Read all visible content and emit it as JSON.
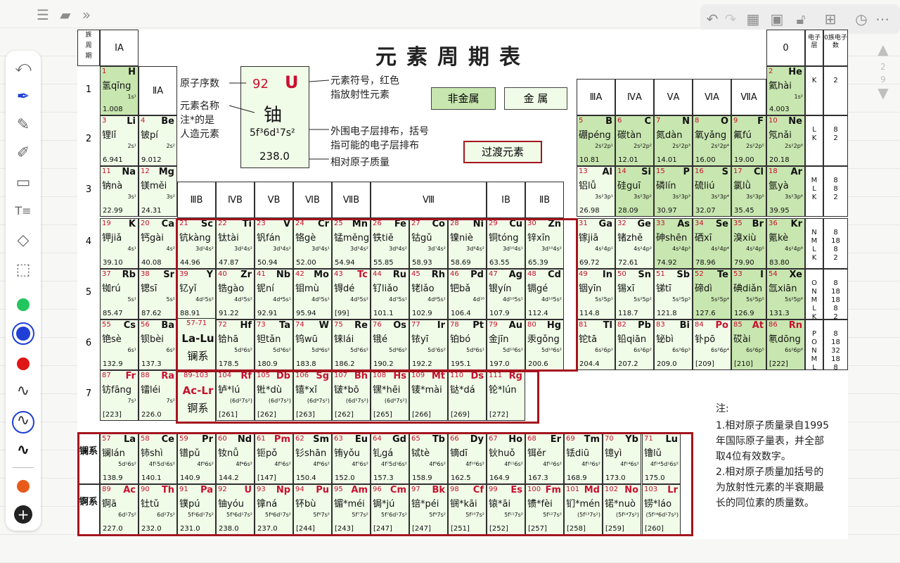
{
  "page": {
    "title": "元素周期表"
  },
  "toolbar_icons": [
    "undo-icon",
    "redo-icon",
    "hatch-icon",
    "save-icon",
    "lock-icon",
    "export-icon",
    "clock-icon",
    "more-icon"
  ],
  "pager": {
    "current": "2",
    "total": "9"
  },
  "colors": {
    "nonmetal": "#c8e6b0",
    "metal": "#f0fbe8",
    "border_red": "#a4151f",
    "symbol_red": "#c8102e",
    "tool_green": "#22c55e",
    "tool_blue": "#1f3fd6",
    "tool_red": "#e01515",
    "tool_orange": "#e85a1a"
  },
  "headers": {
    "corner_top": "族",
    "corner_mid": "周",
    "corner_bottom": "期",
    "g1": "ⅠA",
    "g2": "ⅡA",
    "g13": "ⅢA",
    "g14": "ⅣA",
    "g15": "ⅤA",
    "g16": "ⅥA",
    "g17": "ⅦA",
    "g0": "0",
    "shell_header": "电子层",
    "count_header": "0族电子数",
    "tm": [
      "ⅢB",
      "ⅣB",
      "ⅤB",
      "ⅥB",
      "ⅦB",
      "Ⅷ",
      "ⅠB",
      "ⅡB"
    ]
  },
  "periods": [
    "1",
    "2",
    "3",
    "4",
    "5",
    "6",
    "7"
  ],
  "legend": {
    "z": "92",
    "sym": "U",
    "name": "铀",
    "config": "5f³6d¹7s²",
    "mass": "238.0",
    "l_z": "原子序数",
    "l_name": "元素名称",
    "l_star1": "注*的是",
    "l_star2": "人造元素",
    "l_sym1": "元素符号，红色",
    "l_sym2": "指放射性元素",
    "l_cfg1": "外围电子层排布，括号",
    "l_cfg2": "指可能的电子层排布",
    "l_mass": "相对原子质量",
    "nonmetal": "非金属",
    "metal": "金 属",
    "transition": "过渡元素"
  },
  "series_labels": {
    "la": "镧系",
    "ac": "锕系",
    "la_ref": "57-71",
    "la_sym": "La-Lu",
    "ac_ref": "89-103",
    "ac_sym": "Ac-Lr"
  },
  "notes": {
    "title": "注:",
    "lines": [
      "1.相对原子质量录自1995",
      "年国际原子量表，并全部",
      "取4位有效数字。",
      "2.相对原子质量加括号的",
      "为放射性元素的半衰期最",
      "长的同位素的质量数。"
    ]
  },
  "elements": [
    {
      "z": "1",
      "sym": "H",
      "name": "氢qīng",
      "cfg": "1s¹",
      "mass": "1.008",
      "row": 1,
      "col": 1,
      "t": "nm"
    },
    {
      "z": "2",
      "sym": "He",
      "name": "氦hài",
      "cfg": "1s²",
      "mass": "4.003",
      "row": 1,
      "col": 18,
      "t": "nm"
    },
    {
      "z": "3",
      "sym": "Li",
      "name": "锂lǐ",
      "cfg": "2s¹",
      "mass": "6.941",
      "row": 2,
      "col": 1,
      "t": "mt"
    },
    {
      "z": "4",
      "sym": "Be",
      "name": "铍pí",
      "cfg": "2s²",
      "mass": "9.012",
      "row": 2,
      "col": 2,
      "t": "mt"
    },
    {
      "z": "5",
      "sym": "B",
      "name": "硼péng",
      "cfg": "2s²2p¹",
      "mass": "10.81",
      "row": 2,
      "col": 13,
      "t": "nm"
    },
    {
      "z": "6",
      "sym": "C",
      "name": "碳tàn",
      "cfg": "2s²2p²",
      "mass": "12.01",
      "row": 2,
      "col": 14,
      "t": "nm"
    },
    {
      "z": "7",
      "sym": "N",
      "name": "氮dàn",
      "cfg": "2s²2p³",
      "mass": "14.01",
      "row": 2,
      "col": 15,
      "t": "nm"
    },
    {
      "z": "8",
      "sym": "O",
      "name": "氧yǎng",
      "cfg": "2s²2p⁴",
      "mass": "16.00",
      "row": 2,
      "col": 16,
      "t": "nm"
    },
    {
      "z": "9",
      "sym": "F",
      "name": "氟fú",
      "cfg": "2s²2p⁵",
      "mass": "19.00",
      "row": 2,
      "col": 17,
      "t": "nm"
    },
    {
      "z": "10",
      "sym": "Ne",
      "name": "氖nǎi",
      "cfg": "2s²2p⁶",
      "mass": "20.18",
      "row": 2,
      "col": 18,
      "t": "nm"
    },
    {
      "z": "11",
      "sym": "Na",
      "name": "钠nà",
      "cfg": "3s¹",
      "mass": "22.99",
      "row": 3,
      "col": 1,
      "t": "mt"
    },
    {
      "z": "12",
      "sym": "Mg",
      "name": "镁měi",
      "cfg": "3s²",
      "mass": "24.31",
      "row": 3,
      "col": 2,
      "t": "mt"
    },
    {
      "z": "13",
      "sym": "Al",
      "name": "铝lǚ",
      "cfg": "3s²3p¹",
      "mass": "26.98",
      "row": 3,
      "col": 13,
      "t": "mt"
    },
    {
      "z": "14",
      "sym": "Si",
      "name": "硅guī",
      "cfg": "3s²3p²",
      "mass": "28.09",
      "row": 3,
      "col": 14,
      "t": "nm"
    },
    {
      "z": "15",
      "sym": "P",
      "name": "磷lín",
      "cfg": "3s²3p³",
      "mass": "30.97",
      "row": 3,
      "col": 15,
      "t": "nm"
    },
    {
      "z": "16",
      "sym": "S",
      "name": "硫liú",
      "cfg": "3s²3p⁴",
      "mass": "32.07",
      "row": 3,
      "col": 16,
      "t": "nm"
    },
    {
      "z": "17",
      "sym": "Cl",
      "name": "氯lǜ",
      "cfg": "3s²3p⁵",
      "mass": "35.45",
      "row": 3,
      "col": 17,
      "t": "nm"
    },
    {
      "z": "18",
      "sym": "Ar",
      "name": "氩yà",
      "cfg": "3s²3p⁶",
      "mass": "39.95",
      "row": 3,
      "col": 18,
      "t": "nm"
    },
    {
      "z": "19",
      "sym": "K",
      "name": "钾jiǎ",
      "cfg": "4s¹",
      "mass": "39.10",
      "row": 4,
      "col": 1,
      "t": "mt"
    },
    {
      "z": "20",
      "sym": "Ca",
      "name": "钙gài",
      "cfg": "4s²",
      "mass": "40.08",
      "row": 4,
      "col": 2,
      "t": "mt"
    },
    {
      "z": "21",
      "sym": "Sc",
      "name": "钪kàng",
      "cfg": "3d¹4s²",
      "mass": "44.96",
      "row": 4,
      "col": 3,
      "t": "mt"
    },
    {
      "z": "22",
      "sym": "Ti",
      "name": "钛tài",
      "cfg": "3d²4s²",
      "mass": "47.87",
      "row": 4,
      "col": 4,
      "t": "mt"
    },
    {
      "z": "23",
      "sym": "V",
      "name": "钒fán",
      "cfg": "3d³4s²",
      "mass": "50.94",
      "row": 4,
      "col": 5,
      "t": "mt"
    },
    {
      "z": "24",
      "sym": "Cr",
      "name": "铬gè",
      "cfg": "3d⁵4s¹",
      "mass": "52.00",
      "row": 4,
      "col": 6,
      "t": "mt"
    },
    {
      "z": "25",
      "sym": "Mn",
      "name": "锰měng",
      "cfg": "3d⁵4s²",
      "mass": "54.94",
      "row": 4,
      "col": 7,
      "t": "mt"
    },
    {
      "z": "26",
      "sym": "Fe",
      "name": "铁tiě",
      "cfg": "3d⁶4s²",
      "mass": "55.85",
      "row": 4,
      "col": 8,
      "t": "mt"
    },
    {
      "z": "27",
      "sym": "Co",
      "name": "钴gǔ",
      "cfg": "3d⁷4s²",
      "mass": "58.93",
      "row": 4,
      "col": 9,
      "t": "mt"
    },
    {
      "z": "28",
      "sym": "Ni",
      "name": "镍niè",
      "cfg": "3d⁸4s²",
      "mass": "58.69",
      "row": 4,
      "col": 10,
      "t": "mt"
    },
    {
      "z": "29",
      "sym": "Cu",
      "name": "铜tóng",
      "cfg": "3d¹⁰4s¹",
      "mass": "63.55",
      "row": 4,
      "col": 11,
      "t": "mt"
    },
    {
      "z": "30",
      "sym": "Zn",
      "name": "锌xīn",
      "cfg": "3d¹⁰4s²",
      "mass": "65.39",
      "row": 4,
      "col": 12,
      "t": "mt"
    },
    {
      "z": "31",
      "sym": "Ga",
      "name": "镓jiā",
      "cfg": "4s²4p¹",
      "mass": "69.72",
      "row": 4,
      "col": 13,
      "t": "mt"
    },
    {
      "z": "32",
      "sym": "Ge",
      "name": "锗zhě",
      "cfg": "4s²4p²",
      "mass": "72.61",
      "row": 4,
      "col": 14,
      "t": "mt"
    },
    {
      "z": "33",
      "sym": "As",
      "name": "砷shēn",
      "cfg": "4s²4p³",
      "mass": "74.92",
      "row": 4,
      "col": 15,
      "t": "nm"
    },
    {
      "z": "34",
      "sym": "Se",
      "name": "硒xī",
      "cfg": "4s²4p⁴",
      "mass": "78.96",
      "row": 4,
      "col": 16,
      "t": "nm"
    },
    {
      "z": "35",
      "sym": "Br",
      "name": "溴xiù",
      "cfg": "4s²4p⁵",
      "mass": "79.90",
      "row": 4,
      "col": 17,
      "t": "nm"
    },
    {
      "z": "36",
      "sym": "Kr",
      "name": "氪kè",
      "cfg": "4s²4p⁶",
      "mass": "83.80",
      "row": 4,
      "col": 18,
      "t": "nm"
    },
    {
      "z": "37",
      "sym": "Rb",
      "name": "铷rú",
      "cfg": "5s¹",
      "mass": "85.47",
      "row": 5,
      "col": 1,
      "t": "mt"
    },
    {
      "z": "38",
      "sym": "Sr",
      "name": "锶sī",
      "cfg": "5s²",
      "mass": "87.62",
      "row": 5,
      "col": 2,
      "t": "mt"
    },
    {
      "z": "39",
      "sym": "Y",
      "name": "钇yǐ",
      "cfg": "4d¹5s²",
      "mass": "88.91",
      "row": 5,
      "col": 3,
      "t": "mt"
    },
    {
      "z": "40",
      "sym": "Zr",
      "name": "锆gào",
      "cfg": "4d²5s²",
      "mass": "91.22",
      "row": 5,
      "col": 4,
      "t": "mt"
    },
    {
      "z": "41",
      "sym": "Nb",
      "name": "铌ní",
      "cfg": "4d⁴5s¹",
      "mass": "92.91",
      "row": 5,
      "col": 5,
      "t": "mt"
    },
    {
      "z": "42",
      "sym": "Mo",
      "name": "钼mù",
      "cfg": "4d⁵5s¹",
      "mass": "95.94",
      "row": 5,
      "col": 6,
      "t": "mt"
    },
    {
      "z": "43",
      "sym": "Tc",
      "name": "锝dé",
      "cfg": "4d⁵5s²",
      "mass": "[99]",
      "row": 5,
      "col": 7,
      "t": "mt"
    },
    {
      "z": "44",
      "sym": "Ru",
      "name": "钌liǎo",
      "cfg": "4d⁷5s¹",
      "mass": "101.1",
      "row": 5,
      "col": 8,
      "t": "mt"
    },
    {
      "z": "45",
      "sym": "Rh",
      "name": "铑lǎo",
      "cfg": "4d⁸5s¹",
      "mass": "102.9",
      "row": 5,
      "col": 9,
      "t": "mt"
    },
    {
      "z": "46",
      "sym": "Pd",
      "name": "钯bǎ",
      "cfg": "4d¹⁰",
      "mass": "106.4",
      "row": 5,
      "col": 10,
      "t": "mt"
    },
    {
      "z": "47",
      "sym": "Ag",
      "name": "银yín",
      "cfg": "4d¹⁰5s¹",
      "mass": "107.9",
      "row": 5,
      "col": 11,
      "t": "mt"
    },
    {
      "z": "48",
      "sym": "Cd",
      "name": "镉gé",
      "cfg": "4d¹⁰5s²",
      "mass": "112.4",
      "row": 5,
      "col": 12,
      "t": "mt"
    },
    {
      "z": "49",
      "sym": "In",
      "name": "铟yīn",
      "cfg": "5s²5p¹",
      "mass": "114.8",
      "row": 5,
      "col": 13,
      "t": "mt"
    },
    {
      "z": "50",
      "sym": "Sn",
      "name": "锡xī",
      "cfg": "5s²5p²",
      "mass": "118.7",
      "row": 5,
      "col": 14,
      "t": "mt"
    },
    {
      "z": "51",
      "sym": "Sb",
      "name": "锑tī",
      "cfg": "5s²5p³",
      "mass": "121.8",
      "row": 5,
      "col": 15,
      "t": "mt"
    },
    {
      "z": "52",
      "sym": "Te",
      "name": "碲dì",
      "cfg": "5s²5p⁴",
      "mass": "127.6",
      "row": 5,
      "col": 16,
      "t": "nm"
    },
    {
      "z": "53",
      "sym": "I",
      "name": "碘diǎn",
      "cfg": "5s²5p⁵",
      "mass": "126.9",
      "row": 5,
      "col": 17,
      "t": "nm"
    },
    {
      "z": "54",
      "sym": "Xe",
      "name": "氙xiān",
      "cfg": "5s²5p⁶",
      "mass": "131.3",
      "row": 5,
      "col": 18,
      "t": "nm"
    },
    {
      "z": "55",
      "sym": "Cs",
      "name": "铯sè",
      "cfg": "6s¹",
      "mass": "132.9",
      "row": 6,
      "col": 1,
      "t": "mt"
    },
    {
      "z": "56",
      "sym": "Ba",
      "name": "钡bèi",
      "cfg": "6s²",
      "mass": "137.3",
      "row": 6,
      "col": 2,
      "t": "mt"
    },
    {
      "z": "72",
      "sym": "Hf",
      "name": "铪hā",
      "cfg": "5d²6s²",
      "mass": "178.5",
      "row": 6,
      "col": 4,
      "t": "mt"
    },
    {
      "z": "73",
      "sym": "Ta",
      "name": "钽tǎn",
      "cfg": "5d³6s²",
      "mass": "180.9",
      "row": 6,
      "col": 5,
      "t": "mt"
    },
    {
      "z": "74",
      "sym": "W",
      "name": "钨wū",
      "cfg": "5d⁴6s²",
      "mass": "183.8",
      "row": 6,
      "col": 6,
      "t": "mt"
    },
    {
      "z": "75",
      "sym": "Re",
      "name": "铼lái",
      "cfg": "5d⁵6s²",
      "mass": "186.2",
      "row": 6,
      "col": 7,
      "t": "mt"
    },
    {
      "z": "76",
      "sym": "Os",
      "name": "锇é",
      "cfg": "5d⁶6s²",
      "mass": "190.2",
      "row": 6,
      "col": 8,
      "t": "mt"
    },
    {
      "z": "77",
      "sym": "Ir",
      "name": "铱yī",
      "cfg": "5d⁷6s²",
      "mass": "192.2",
      "row": 6,
      "col": 9,
      "t": "mt"
    },
    {
      "z": "78",
      "sym": "Pt",
      "name": "铂bó",
      "cfg": "5d⁹6s¹",
      "mass": "195.1",
      "row": 6,
      "col": 10,
      "t": "mt"
    },
    {
      "z": "79",
      "sym": "Au",
      "name": "金jīn",
      "cfg": "5d¹⁰6s¹",
      "mass": "197.0",
      "row": 6,
      "col": 11,
      "t": "mt"
    },
    {
      "z": "80",
      "sym": "Hg",
      "name": "汞gǒng",
      "cfg": "5d¹⁰6s²",
      "mass": "200.6",
      "row": 6,
      "col": 12,
      "t": "mt"
    },
    {
      "z": "81",
      "sym": "Tl",
      "name": "铊tā",
      "cfg": "6s²6p¹",
      "mass": "204.4",
      "row": 6,
      "col": 13,
      "t": "mt"
    },
    {
      "z": "82",
      "sym": "Pb",
      "name": "铅qiān",
      "cfg": "6s²6p²",
      "mass": "207.2",
      "row": 6,
      "col": 14,
      "t": "mt"
    },
    {
      "z": "83",
      "sym": "Bi",
      "name": "铋bì",
      "cfg": "6s²6p³",
      "mass": "209.0",
      "row": 6,
      "col": 15,
      "t": "mt"
    },
    {
      "z": "84",
      "sym": "Po",
      "name": "钋pō",
      "cfg": "6s²6p⁴",
      "mass": "[209]",
      "row": 6,
      "col": 16,
      "t": "mt"
    },
    {
      "z": "85",
      "sym": "At",
      "name": "砹ài",
      "cfg": "6s²6p⁵",
      "mass": "[210]",
      "row": 6,
      "col": 17,
      "t": "nm"
    },
    {
      "z": "86",
      "sym": "Rn",
      "name": "氡dōng",
      "cfg": "6s²6p⁶",
      "mass": "[222]",
      "row": 6,
      "col": 18,
      "t": "nm"
    },
    {
      "z": "87",
      "sym": "Fr",
      "name": "钫fāng",
      "cfg": "7s¹",
      "mass": "[223]",
      "row": 7,
      "col": 1,
      "t": "mt"
    },
    {
      "z": "88",
      "sym": "Ra",
      "name": "镭léi",
      "cfg": "7s²",
      "mass": "226.0",
      "row": 7,
      "col": 2,
      "t": "mt"
    },
    {
      "z": "104",
      "sym": "Rf",
      "name": "𬬻*lú",
      "cfg": "(6d²7s²)",
      "mass": "[261]",
      "row": 7,
      "col": 4,
      "t": "mt"
    },
    {
      "z": "105",
      "sym": "Db",
      "name": "𬭊*dù",
      "cfg": "(6d³7s²)",
      "mass": "[262]",
      "row": 7,
      "col": 5,
      "t": "mt"
    },
    {
      "z": "106",
      "sym": "Sg",
      "name": "𬭳*xǐ",
      "cfg": "(6d⁴7s²)",
      "mass": "[263]",
      "row": 7,
      "col": 6,
      "t": "mt"
    },
    {
      "z": "107",
      "sym": "Bh",
      "name": "𬭛*bō",
      "cfg": "(6d⁵7s²)",
      "mass": "[262]",
      "row": 7,
      "col": 7,
      "t": "mt"
    },
    {
      "z": "108",
      "sym": "Hs",
      "name": "𬭶*hēi",
      "cfg": "(6d⁶7s²)",
      "mass": "[265]",
      "row": 7,
      "col": 8,
      "t": "mt"
    },
    {
      "z": "109",
      "sym": "Mt",
      "name": "鿏*mài",
      "cfg": "",
      "mass": "[266]",
      "row": 7,
      "col": 9,
      "t": "mt"
    },
    {
      "z": "110",
      "sym": "Ds",
      "name": "𫟼*dá",
      "cfg": "",
      "mass": "[269]",
      "row": 7,
      "col": 10,
      "t": "mt"
    },
    {
      "z": "111",
      "sym": "Rg",
      "name": "𬬭*lún",
      "cfg": "",
      "mass": "[272]",
      "row": 7,
      "col": 11,
      "t": "mt"
    }
  ],
  "lanthanides": [
    {
      "z": "57",
      "sym": "La",
      "name": "镧lán",
      "cfg": "5d¹6s²",
      "mass": "138.9"
    },
    {
      "z": "58",
      "sym": "Ce",
      "name": "铈shì",
      "cfg": "4f¹5d¹6s²",
      "mass": "140.1"
    },
    {
      "z": "59",
      "sym": "Pr",
      "name": "镨pǔ",
      "cfg": "4f³6s²",
      "mass": "140.9"
    },
    {
      "z": "60",
      "sym": "Nd",
      "name": "钕nǚ",
      "cfg": "4f⁴6s²",
      "mass": "144.2"
    },
    {
      "z": "61",
      "sym": "Pm",
      "name": "钷pǒ",
      "cfg": "4f⁵6s²",
      "mass": "[147]"
    },
    {
      "z": "62",
      "sym": "Sm",
      "name": "钐shān",
      "cfg": "4f⁶6s²",
      "mass": "150.4"
    },
    {
      "z": "63",
      "sym": "Eu",
      "name": "铕yǒu",
      "cfg": "4f⁷6s²",
      "mass": "152.0"
    },
    {
      "z": "64",
      "sym": "Gd",
      "name": "钆gá",
      "cfg": "4f⁷5d¹6s²",
      "mass": "157.3"
    },
    {
      "z": "65",
      "sym": "Tb",
      "name": "铽tè",
      "cfg": "4f⁹6s²",
      "mass": "158.9"
    },
    {
      "z": "66",
      "sym": "Dy",
      "name": "镝dī",
      "cfg": "4f¹⁰6s²",
      "mass": "162.5"
    },
    {
      "z": "67",
      "sym": "Ho",
      "name": "钬huǒ",
      "cfg": "4f¹¹6s²",
      "mass": "164.9"
    },
    {
      "z": "68",
      "sym": "Er",
      "name": "铒ěr",
      "cfg": "4f¹²6s²",
      "mass": "167.3"
    },
    {
      "z": "69",
      "sym": "Tm",
      "name": "铥diū",
      "cfg": "4f¹³6s²",
      "mass": "168.9"
    },
    {
      "z": "70",
      "sym": "Yb",
      "name": "镱yì",
      "cfg": "4f¹⁴6s²",
      "mass": "173.0"
    },
    {
      "z": "71",
      "sym": "Lu",
      "name": "镥lǔ",
      "cfg": "4f¹⁴5d¹6s²",
      "mass": "175.0"
    }
  ],
  "actinides": [
    {
      "z": "89",
      "sym": "Ac",
      "name": "锕ā",
      "cfg": "6d¹7s²",
      "mass": "227.0"
    },
    {
      "z": "90",
      "sym": "Th",
      "name": "钍tǔ",
      "cfg": "6d²7s²",
      "mass": "232.0"
    },
    {
      "z": "91",
      "sym": "Pa",
      "name": "镤pú",
      "cfg": "5f²6d¹7s²",
      "mass": "231.0"
    },
    {
      "z": "92",
      "sym": "U",
      "name": "铀yóu",
      "cfg": "5f³6d¹7s²",
      "mass": "238.0"
    },
    {
      "z": "93",
      "sym": "Np",
      "name": "镎ná",
      "cfg": "5f⁴6d¹7s²",
      "mass": "237.0"
    },
    {
      "z": "94",
      "sym": "Pu",
      "name": "钚bù",
      "cfg": "5f⁶7s²",
      "mass": "[244]"
    },
    {
      "z": "95",
      "sym": "Am",
      "name": "镅*méi",
      "cfg": "5f⁷7s²",
      "mass": "[243]"
    },
    {
      "z": "96",
      "sym": "Cm",
      "name": "锔*jú",
      "cfg": "5f⁷6d¹7s²",
      "mass": "[247]"
    },
    {
      "z": "97",
      "sym": "Bk",
      "name": "锫*péi",
      "cfg": "5f⁹7s²",
      "mass": "[247]"
    },
    {
      "z": "98",
      "sym": "Cf",
      "name": "锎*kāi",
      "cfg": "5f¹⁰7s²",
      "mass": "[251]"
    },
    {
      "z": "99",
      "sym": "Es",
      "name": "锿*āi",
      "cfg": "5f¹¹7s²",
      "mass": "[252]"
    },
    {
      "z": "100",
      "sym": "Fm",
      "name": "镄*fèi",
      "cfg": "5f¹²7s²",
      "mass": "[257]"
    },
    {
      "z": "101",
      "sym": "Md",
      "name": "钔*mén",
      "cfg": "(5f¹³7s²)",
      "mass": "[258]"
    },
    {
      "z": "102",
      "sym": "No",
      "name": "锘*nuò",
      "cfg": "(5f¹⁴7s²)",
      "mass": "[259]"
    },
    {
      "z": "103",
      "sym": "Lr",
      "name": "铹*láo",
      "cfg": "(5f¹⁴6d¹7s²)",
      "mass": "[260]"
    }
  ],
  "shells": [
    {
      "row": 1,
      "shells": "K",
      "count": "2"
    },
    {
      "row": 2,
      "shells": "L K",
      "count": "8 2"
    },
    {
      "row": 3,
      "shells": "M L K",
      "count": "8 8 2"
    },
    {
      "row": 4,
      "shells": "N M L K",
      "count": "8 18 8 2"
    },
    {
      "row": 5,
      "shells": "O N M L K",
      "count": "8 18 18 8 2"
    },
    {
      "row": 6,
      "shells": "P O N M L K",
      "count": "8 18 32 18 8 2"
    }
  ]
}
